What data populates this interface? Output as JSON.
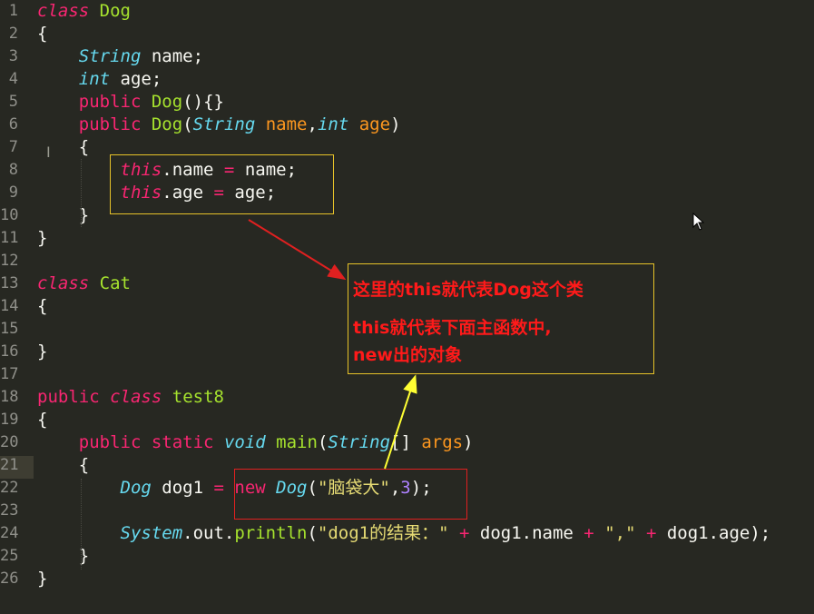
{
  "editor": {
    "current_line": 21,
    "gutter": [
      "1",
      "2",
      "3",
      "4",
      "5",
      "6",
      "7",
      "8",
      "9",
      "10",
      "11",
      "12",
      "13",
      "14",
      "15",
      "16",
      "17",
      "18",
      "19",
      "20",
      "21",
      "22",
      "23",
      "24",
      "25",
      "26"
    ],
    "lines": [
      [
        {
          "t": "class",
          "c": "kwi"
        },
        {
          "t": " "
        },
        {
          "t": "Dog",
          "c": "cls"
        }
      ],
      [
        {
          "t": "{"
        }
      ],
      [
        {
          "t": "    "
        },
        {
          "t": "String",
          "c": "ty"
        },
        {
          "t": " name;"
        }
      ],
      [
        {
          "t": "    "
        },
        {
          "t": "int",
          "c": "ty"
        },
        {
          "t": " age;"
        }
      ],
      [
        {
          "t": "    "
        },
        {
          "t": "public",
          "c": "kw"
        },
        {
          "t": " "
        },
        {
          "t": "Dog",
          "c": "fn"
        },
        {
          "t": "(){}"
        }
      ],
      [
        {
          "t": "    "
        },
        {
          "t": "public",
          "c": "kw"
        },
        {
          "t": " "
        },
        {
          "t": "Dog",
          "c": "fn"
        },
        {
          "t": "("
        },
        {
          "t": "String",
          "c": "ty"
        },
        {
          "t": " "
        },
        {
          "t": "name",
          "c": "par"
        },
        {
          "t": ","
        },
        {
          "t": "int",
          "c": "ty"
        },
        {
          "t": " "
        },
        {
          "t": "age",
          "c": "par"
        },
        {
          "t": ")"
        }
      ],
      [
        {
          "t": "    {"
        }
      ],
      [
        {
          "t": "        "
        },
        {
          "t": "this",
          "c": "kwi"
        },
        {
          "t": ".name "
        },
        {
          "t": "=",
          "c": "kw"
        },
        {
          "t": " name;"
        }
      ],
      [
        {
          "t": "        "
        },
        {
          "t": "this",
          "c": "kwi"
        },
        {
          "t": ".age "
        },
        {
          "t": "=",
          "c": "kw"
        },
        {
          "t": " age;"
        }
      ],
      [
        {
          "t": "    }"
        }
      ],
      [
        {
          "t": "}"
        }
      ],
      [],
      [
        {
          "t": "class",
          "c": "kwi"
        },
        {
          "t": " "
        },
        {
          "t": "Cat",
          "c": "cls"
        }
      ],
      [
        {
          "t": "{"
        }
      ],
      [],
      [
        {
          "t": "}"
        }
      ],
      [],
      [
        {
          "t": "public",
          "c": "kw"
        },
        {
          "t": " "
        },
        {
          "t": "class",
          "c": "kwi"
        },
        {
          "t": " "
        },
        {
          "t": "test8",
          "c": "cls"
        }
      ],
      [
        {
          "t": "{"
        }
      ],
      [
        {
          "t": "    "
        },
        {
          "t": "public",
          "c": "kw"
        },
        {
          "t": " "
        },
        {
          "t": "static",
          "c": "kw"
        },
        {
          "t": " "
        },
        {
          "t": "void",
          "c": "ty"
        },
        {
          "t": " "
        },
        {
          "t": "main",
          "c": "fn"
        },
        {
          "t": "("
        },
        {
          "t": "String",
          "c": "ty"
        },
        {
          "t": "[] "
        },
        {
          "t": "args",
          "c": "par"
        },
        {
          "t": ")"
        }
      ],
      [
        {
          "t": "    {"
        }
      ],
      [
        {
          "t": "        "
        },
        {
          "t": "Dog",
          "c": "ty"
        },
        {
          "t": " dog1 "
        },
        {
          "t": "=",
          "c": "kw"
        },
        {
          "t": " "
        },
        {
          "t": "new",
          "c": "kw"
        },
        {
          "t": " "
        },
        {
          "t": "Dog",
          "c": "ty"
        },
        {
          "t": "("
        },
        {
          "t": "\"脑袋大\"",
          "c": "str"
        },
        {
          "t": ","
        },
        {
          "t": "3",
          "c": "num"
        },
        {
          "t": ");"
        }
      ],
      [],
      [
        {
          "t": "        "
        },
        {
          "t": "System",
          "c": "ty"
        },
        {
          "t": ".out."
        },
        {
          "t": "println",
          "c": "fn"
        },
        {
          "t": "("
        },
        {
          "t": "\"dog1的结果：\"",
          "c": "str"
        },
        {
          "t": " "
        },
        {
          "t": "+",
          "c": "kw"
        },
        {
          "t": " dog1.name "
        },
        {
          "t": "+",
          "c": "kw"
        },
        {
          "t": " "
        },
        {
          "t": "\",\"",
          "c": "str"
        },
        {
          "t": " "
        },
        {
          "t": "+",
          "c": "kw"
        },
        {
          "t": " dog1.age);"
        }
      ],
      [
        {
          "t": "    }"
        }
      ],
      [
        {
          "t": "}"
        }
      ]
    ]
  },
  "annotation": {
    "line1": "这里的this就代表Dog这个类",
    "line2": "this就代表下面主函数中,",
    "line3": "new出的对象"
  },
  "colors": {
    "background": "#272822",
    "note_text": "#ff1a1a",
    "box_yellow": "#e6c229",
    "box_red": "#e02020",
    "arrow_red": "#e02020",
    "arrow_yellow": "#ffff33"
  }
}
